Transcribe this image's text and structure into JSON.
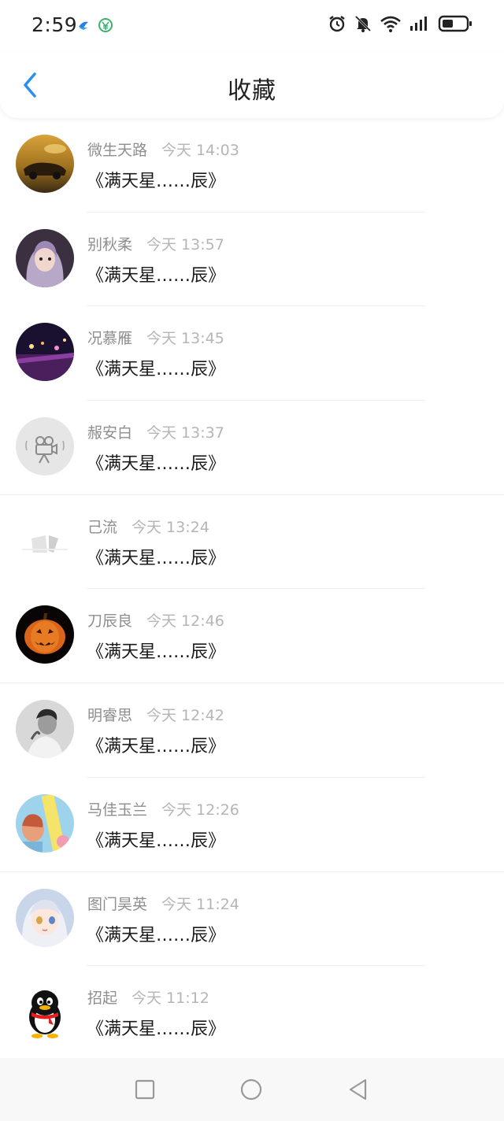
{
  "status_bar": {
    "time": "2:59",
    "icons": [
      "cloud-app-icon",
      "wechat-pay-icon",
      "alarm-icon",
      "mute-bell-icon",
      "wifi-icon",
      "signal-icon",
      "battery-icon"
    ]
  },
  "header": {
    "title": "收藏",
    "back_icon": "chevron-left-icon",
    "accent_color": "#2a8ff0"
  },
  "items": [
    {
      "name": "微生天路",
      "time": "今天 14:03",
      "content": "《满天星……辰》",
      "avatar": "car-photo"
    },
    {
      "name": "别秋柔",
      "time": "今天 13:57",
      "content": "《满天星……辰》",
      "avatar": "girl-photo"
    },
    {
      "name": "况慕雁",
      "time": "今天 13:45",
      "content": "《满天星……辰》",
      "avatar": "night-scene-photo"
    },
    {
      "name": "赧安白",
      "time": "今天 13:37",
      "content": "《满天星……辰》",
      "avatar": "camera-placeholder"
    },
    {
      "name": "己流",
      "time": "今天 13:24",
      "content": "《满天星……辰》",
      "avatar": "sketch-photo"
    },
    {
      "name": "刀辰良",
      "time": "今天 12:46",
      "content": "《满天星……辰》",
      "avatar": "pumpkin-photo"
    },
    {
      "name": "明睿思",
      "time": "今天 12:42",
      "content": "《满天星……辰》",
      "avatar": "bw-portrait-photo"
    },
    {
      "name": "马佳玉兰",
      "time": "今天 12:26",
      "content": "《满天星……辰》",
      "avatar": "colorful-photo"
    },
    {
      "name": "图门昊英",
      "time": "今天 11:24",
      "content": "《满天星……辰》",
      "avatar": "anime-photo"
    },
    {
      "name": "招起",
      "time": "今天 11:12",
      "content": "《满天星……辰》",
      "avatar": "qq-penguin-icon"
    }
  ],
  "nav_bar": {
    "buttons": [
      "recents-square-icon",
      "home-circle-icon",
      "back-triangle-icon"
    ]
  }
}
